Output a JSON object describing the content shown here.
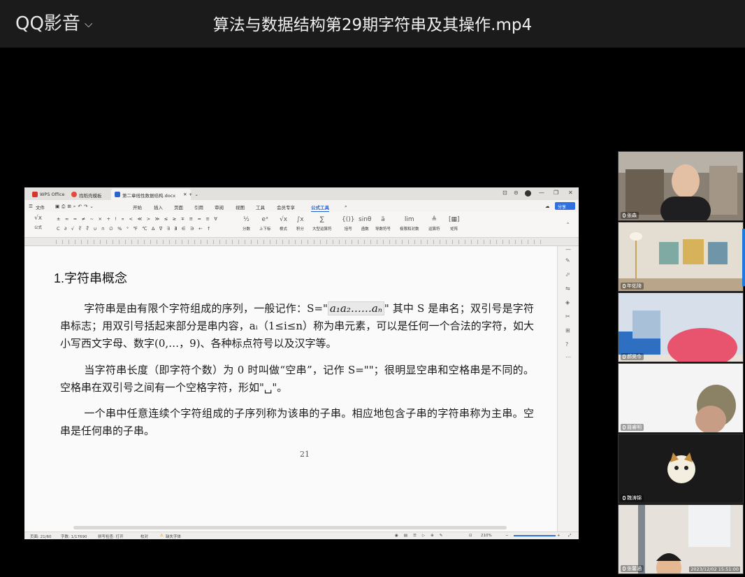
{
  "player": {
    "app_name": "QQ影音",
    "title": "算法与数据结构第29期字符串及其操作.mp4"
  },
  "wps": {
    "tabs": [
      {
        "label": "WPS Office",
        "color": "#d6332a"
      },
      {
        "label": "找稻壳模板",
        "color": "#e5483d"
      },
      {
        "label": "第二章线性数据结构.docx",
        "color": "#2d62c9"
      }
    ],
    "new_tab_label": "+",
    "window_controls": [
      "⊡",
      "⊝",
      "—",
      "❐",
      "✕"
    ],
    "file_menu": "文件",
    "menus": [
      "开始",
      "插入",
      "页面",
      "引用",
      "审阅",
      "视图",
      "工具",
      "会员专享",
      "公式工具"
    ],
    "active_menu": "公式工具",
    "share_label": "分享",
    "ribbon_symbols_row1": "± ∞ = ≠ ~ × + ! ∝ < ≪ > ≫ ≤ ≥ ∓ ≅ ≈ ≡ ∀",
    "ribbon_symbols_row2": "C ∂ √ ∛ ∜ ∪ ∩ ∅ % ° ℉ ℃ Δ ∇ ∃ ∄ ∈ ∋ ← ↑",
    "formula_label": "公式",
    "ribbon_groups": [
      "分数",
      "上下标",
      "根式",
      "积分",
      "大型运算符",
      "括号",
      "函数",
      "导数符号",
      "极限和对数",
      "运算符",
      "矩阵"
    ]
  },
  "document": {
    "heading": "1.字符串概念",
    "para1_a": "字符串是由有限个字符组成的序列，一般记作：S=\"",
    "para1_formula": "a₁a₂……aₙ",
    "para1_b": "\" 其中 S 是串名；双引号是字符串标志；用双引号括起来部分是串内容，aᵢ（1≤i≤n）称为串元素，可以是任何一个合法的字符，如大小写西文字母、数字(0,…，9)、各种标点符号以及汉字等。",
    "para2": "当字符串长度（即字符个数）为 0 时叫做“空串”，记作 S=\"\"；很明显空串和空格串是不同的。空格串在双引号之间有一个空格字符，形如\"␣\"。",
    "para3": "一个串中任意连续个字符组成的子序列称为该串的子串。相应地包含子串的字符串称为主串。空串是任何串的子串。",
    "page_number": "21"
  },
  "statusbar": {
    "page": "页面: 21/60",
    "words": "字数: 1/17690",
    "spell": "拼写检查: 打开",
    "proof": "校对",
    "missing_font": "缺失字体",
    "zoom": "210%"
  },
  "participants": [
    {
      "name": "张森",
      "bg": "#7a6e62"
    },
    {
      "name": "年佑琦",
      "bg": "#d8d2c8"
    },
    {
      "name": "郝昊今",
      "bg": "#c9d6e3"
    },
    {
      "name": "聂睿明",
      "bg": "#f2f2f2"
    },
    {
      "name": "魏涛锦",
      "bg": "#1a1a1a"
    },
    {
      "name": "张馨涵",
      "bg": "#e6e1da"
    }
  ],
  "timestamp": "2023/12/02 15:51:00"
}
